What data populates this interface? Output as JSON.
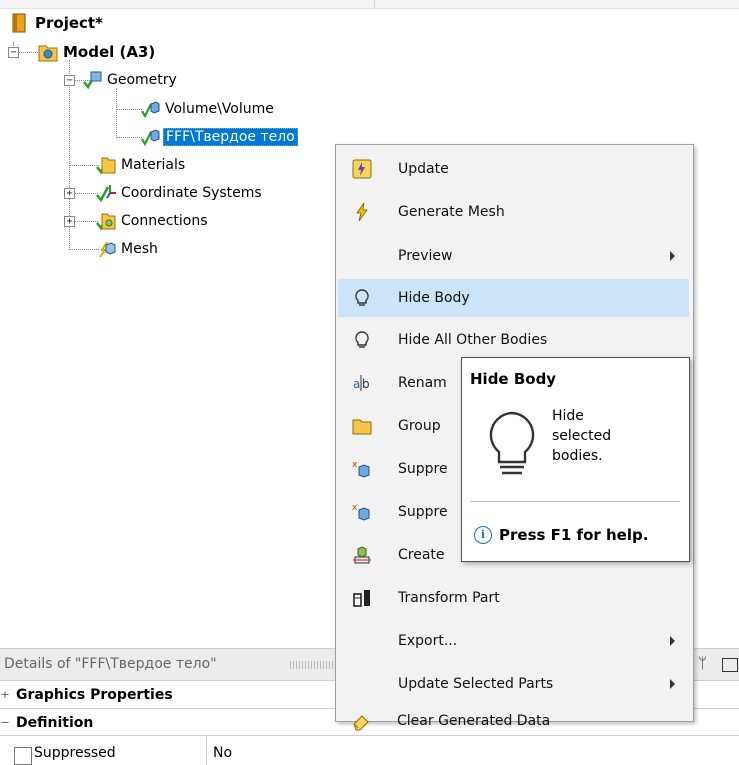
{
  "tree": {
    "project": "Project*",
    "model": "Model (A3)",
    "geometry": "Geometry",
    "body1": "Volume\\Volume",
    "body2": "FFF\\Твердое тело",
    "materials": "Materials",
    "coord": "Coordinate Systems",
    "connections": "Connections",
    "mesh": "Mesh",
    "expander_minus": "−",
    "expander_plus": "+"
  },
  "menu": {
    "items": [
      {
        "label": "Update",
        "icon": "update-icon"
      },
      {
        "label": "Generate Mesh",
        "icon": "lightning-icon"
      },
      {
        "label": "Preview",
        "icon": "",
        "submenu": true
      },
      {
        "label": "Hide Body",
        "icon": "bulb-icon",
        "highlighted": true
      },
      {
        "label": "Hide All Other Bodies",
        "icon": "bulb-icon"
      },
      {
        "label": "Rename",
        "icon": "rename-icon"
      },
      {
        "label": "Group",
        "icon": "folder-icon"
      },
      {
        "label": "Suppress Body",
        "icon": "suppress-icon"
      },
      {
        "label": "Suppress All Other Bodies",
        "icon": "suppress-icon"
      },
      {
        "label": "Create Named Selection",
        "icon": "named-selection-icon"
      },
      {
        "label": "Transform Part",
        "icon": "transform-icon"
      },
      {
        "label": "Export...",
        "icon": "",
        "submenu": true
      },
      {
        "label": "Update Selected Parts",
        "icon": "",
        "submenu": true
      },
      {
        "label": "Clear Generated Data",
        "icon": "eraser-icon"
      }
    ],
    "visible_labels": {
      "rename": "Renam",
      "group": "Group",
      "suppress1": "Suppre",
      "suppress2": "Suppre",
      "create": "Create"
    }
  },
  "tooltip": {
    "title": "Hide Body",
    "line1": "Hide",
    "line2": "selected",
    "line3": "bodies.",
    "help": "Press F1 for help.",
    "info_glyph": "i"
  },
  "details": {
    "title": "Details of \"FFF\\Твердое тело\"",
    "pin_glyph": "ᛘ",
    "rows": [
      {
        "label": "Graphics Properties",
        "toggle": "+"
      },
      {
        "label": "Definition",
        "toggle": "−"
      }
    ],
    "last_row": {
      "key": "Suppressed",
      "value": "No"
    }
  },
  "colors": {
    "selection": "#0078d7",
    "menu_highlight": "#cce4f7",
    "check": "#2aa02a"
  }
}
